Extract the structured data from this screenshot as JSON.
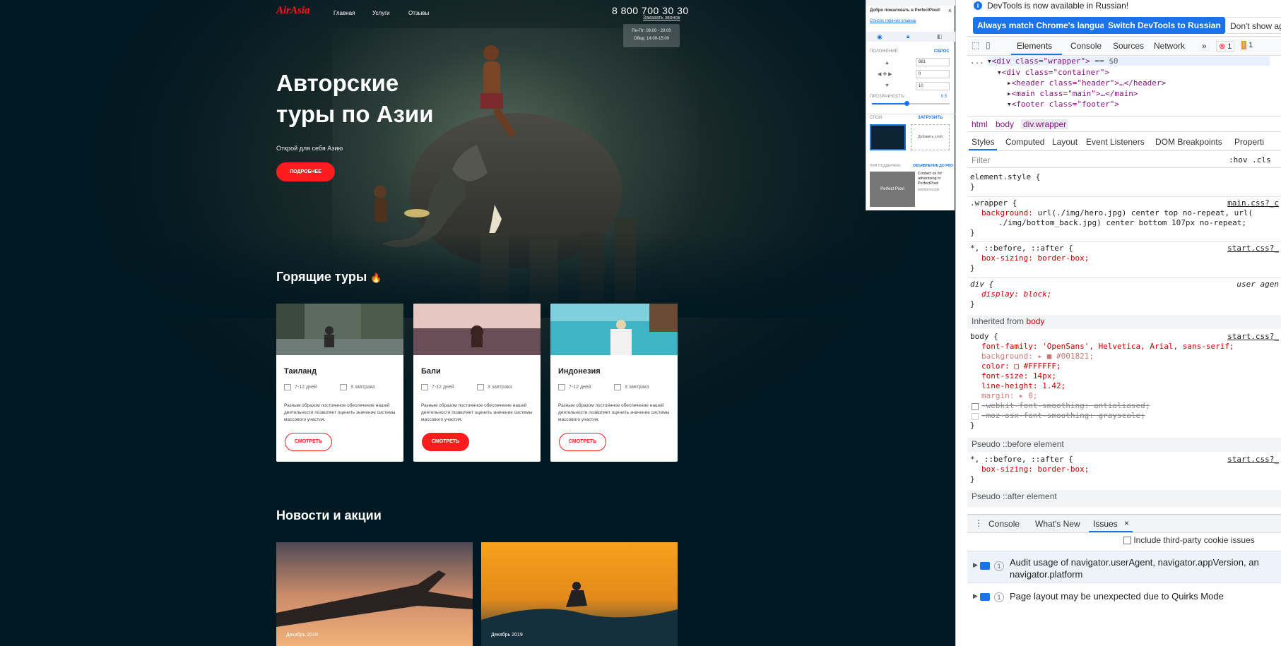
{
  "site": {
    "logo": "AirAsia",
    "nav": [
      "Главная",
      "Услуги",
      "Отзывы"
    ],
    "phone": "8 800 700 30 30",
    "call_link": "Заказать звонок",
    "hours_line1": "Пн-Пт: 09:00 - 20:00",
    "hours_line2": "Обед: 14:00-15:00",
    "hero_title_line1": "Авторские",
    "hero_title_line2": "туры по Азии",
    "hero_subtitle": "Открой для себя Азию",
    "hero_button": "ПОДРОБНЕЕ",
    "hot_tours_title": "Горящие туры",
    "news_title": "Новости и акции",
    "cards": [
      {
        "title": "Таиланд",
        "days": "7-12 дней",
        "food": "3 завтрака",
        "text": "Разным образом постоянное обеспечение нашей деятельности позволяет оценить значение системы массового участия.",
        "button": "СМОТРЕТЬ",
        "button_style": "outline"
      },
      {
        "title": "Бали",
        "days": "7-12 дней",
        "food": "3 завтрака",
        "text": "Разным образом постоянное обеспечение нашей деятельности позволяет оценить значение системы массового участия.",
        "button": "СМОТРЕТЬ",
        "button_style": "filled"
      },
      {
        "title": "Индонезия",
        "days": "7-12 дней",
        "food": "3 завтрака",
        "text": "Разным образом постоянное обеспечение нашей деятельности позволяет оценить значение системы массового участия.",
        "button": "СМОТРЕТЬ",
        "button_style": "outline"
      }
    ],
    "news": [
      {
        "date": "Декабрь 2019"
      },
      {
        "date": "Декабрь 2019"
      }
    ]
  },
  "perfect_pixel": {
    "welcome": "Добро пожаловать в PerfectPixel!",
    "link": "Список горячих клавиш",
    "position_label": "ПОЛОЖЕНИЕ:",
    "reset": "СБРОС",
    "x_value": "881",
    "y_value": "0",
    "scale_value": "10",
    "opacity_label": "ПРОЗРАЧНОСТЬ:",
    "opacity_value": "0.5",
    "layers_label": "СЛОИ:",
    "upload": "ЗАГРУЗИТЬ",
    "add_layer": "Добавить слой",
    "sponsors_label": "ПРИ ПОДДЕРЖКЕ:",
    "advert_link": "ОБЪЯВЛЕНИЕ ДО PRO",
    "ad_title": "Contact us for advertising in PerfectPixel",
    "ad_site": "welldonecode",
    "ad_logo": "Perfect Pixel"
  },
  "devtools": {
    "info": "DevTools is now available in Russian!",
    "btn_match": "Always match Chrome's language",
    "btn_switch": "Switch DevTools to Russian",
    "btn_dont": "Don't show ag",
    "tabs": [
      "Elements",
      "Console",
      "Sources",
      "Network"
    ],
    "more": "»",
    "error_count": "1",
    "warn_count": "1",
    "dom": {
      "line0": "...",
      "wrapper": "div class=\"wrapper\"",
      "wrapper_eq": "== $0",
      "container": "div class=\"container\"",
      "header": "header class=\"header\"",
      "main": "main class=\"main\"",
      "footer": "footer class=\"footer\""
    },
    "crumbs": [
      "html",
      "body",
      "div.wrapper"
    ],
    "subtabs": [
      "Styles",
      "Computed",
      "Layout",
      "Event Listeners",
      "DOM Breakpoints",
      "Properti"
    ],
    "filter_placeholder": "Filter",
    "hov": ":hov .cls",
    "css": {
      "element_style": "element.style {",
      "close": "}",
      "wrapper_sel": ".wrapper {",
      "wrapper_src": "main.css?_c",
      "wrapper_bg_prop": "background:",
      "wrapper_bg_val1": "url(./img/hero.jpg) center top no-repeat, url(",
      "wrapper_bg_val2": "./img/bottom_back.jpg) center bottom 107px no-repeat;",
      "star_sel": "*, ::before, ::after {",
      "start_src": "start.css?_",
      "box_sizing": "box-sizing: border-box;",
      "div_sel": "div {",
      "ua_src": "user agen",
      "display": "display: block;",
      "inherited": "Inherited from",
      "inherited_el": "body",
      "body_sel": "body {",
      "font_family": "font-family: 'OpenSans', Helvetica, Arial, sans-serif;",
      "background": "background: ▸ ■ #001821;",
      "color": "color: □ #FFFFFF;",
      "font_size": "font-size: 14px;",
      "line_height": "line-height: 1.42;",
      "margin": "margin: ▸ 0;",
      "webkit": "-webkit-font-smoothing: antialiased;",
      "moz": "-moz-osx-font-smoothing: grayscale;",
      "pseudo_before": "Pseudo ::before element",
      "pseudo_after": "Pseudo ::after element"
    },
    "drawer_tabs": [
      "Console",
      "What's New",
      "Issues"
    ],
    "third_party": "Include third-party cookie issues",
    "issues": [
      {
        "count": "1",
        "text_line1": "Audit usage of navigator.userAgent, navigator.appVersion, an",
        "text_line2": "navigator.platform"
      },
      {
        "count": "1",
        "text_line1": "Page layout may be unexpected due to Quirks Mode",
        "text_line2": ""
      }
    ]
  }
}
